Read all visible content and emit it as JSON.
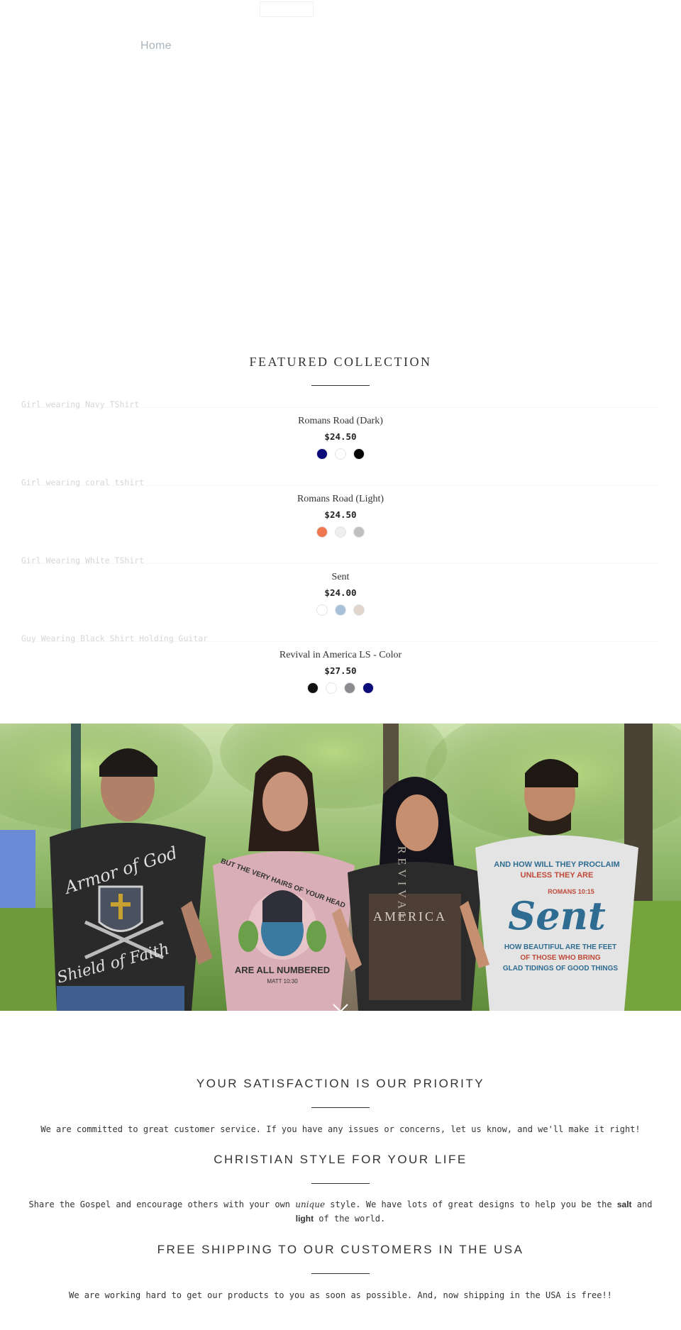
{
  "nav": {
    "home_label": "Home"
  },
  "featured": {
    "title": "FEATURED COLLECTION",
    "products": [
      {
        "image_alt": "Girl wearing Navy TShirt",
        "name": "Romans Road (Dark)",
        "price": "$24.50",
        "swatches": [
          "#0a0a78",
          "#ffffff",
          "#050505"
        ]
      },
      {
        "image_alt": "Girl wearing coral tshirt",
        "name": "Romans Road (Light)",
        "price": "$24.50",
        "swatches": [
          "#f07850",
          "#eeeef0",
          "#c0c0c0"
        ]
      },
      {
        "image_alt": "Girl Wearing White TShirt",
        "name": "Sent",
        "price": "$24.00",
        "swatches": [
          "#ffffff",
          "#a8c0d8",
          "#e2d6cc"
        ]
      },
      {
        "image_alt": "Guy Wearing Black Shirt Holding Guitar",
        "name": "Revival in America LS - Color",
        "price": "$27.50",
        "swatches": [
          "#111111",
          "#ffffff",
          "#8c8c90",
          "#0a0a78"
        ]
      }
    ]
  },
  "hero": {
    "shirt_texts": {
      "armor_top": "Armor of God",
      "armor_bottom": "Shield of Faith",
      "hairs_top": "BUT THE VERY HAIRS OF YOUR HEAD",
      "hairs_bottom": "ARE ALL NUMBERED",
      "hairs_ref": "MATT 10:30",
      "america": "AMERICA",
      "revival": "REVIVAL",
      "sent_top1": "AND HOW WILL THEY PROCLAIM",
      "sent_top2": "UNLESS THEY ARE",
      "sent_ref": "ROMANS 10:15",
      "sent_main": "Sent",
      "sent_b1": "HOW BEAUTIFUL ARE THE FEET",
      "sent_b2": "OF THOSE WHO BRING",
      "sent_b3": "GLAD TIDINGS OF GOOD THINGS"
    }
  },
  "info": [
    {
      "title": "YOUR SATISFACTION IS OUR PRIORITY",
      "text": "We are committed to great customer service. If you have any issues or concerns, let us know, and we'll make it right!"
    },
    {
      "title": "CHRISTIAN STYLE FOR YOUR LIFE",
      "text_a": "Share the Gospel and encourage others with your own ",
      "text_em": "unique",
      "text_b": " style. We have lots of great designs to help you be the ",
      "text_salt": "salt",
      "text_and": " and ",
      "text_light": "light",
      "text_c": " of the world."
    },
    {
      "title": "FREE SHIPPING TO OUR CUSTOMERS IN THE USA",
      "text": "We are working hard to get our products to you as soon as possible. And, now shipping in the USA is free!!"
    }
  ]
}
